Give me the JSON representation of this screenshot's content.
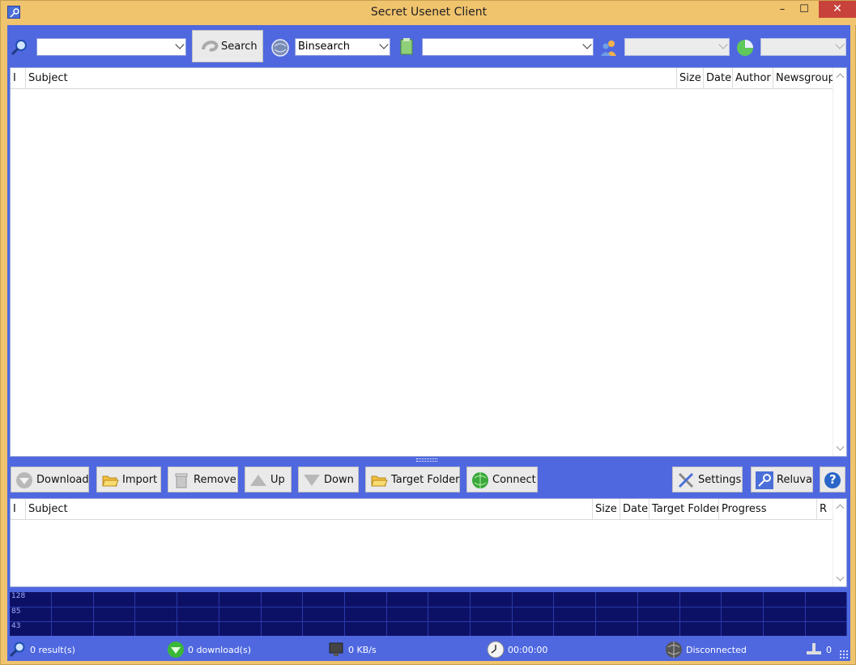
{
  "window": {
    "title": "Secret Usenet Client",
    "minimize": "–",
    "maximize": "☐",
    "close": "✕"
  },
  "toolbar": {
    "search_input": "",
    "search_label": "Search",
    "provider_selected": "Binsearch",
    "group_input": "",
    "user_select": "",
    "other_select": ""
  },
  "results": {
    "columns": [
      "I",
      "Subject",
      "Size",
      "Date",
      "Author",
      "Newsgroup"
    ],
    "rows": []
  },
  "actions": {
    "download": "Download",
    "import": "Import",
    "remove": "Remove",
    "up": "Up",
    "down": "Down",
    "target_folder": "Target Folder",
    "connect": "Connect",
    "settings": "Settings",
    "reluva": "Reluva",
    "help": "?"
  },
  "queue": {
    "columns": [
      "I",
      "Subject",
      "Size",
      "Date",
      "Target Folder",
      "Progress",
      "R"
    ],
    "rows": []
  },
  "graph": {
    "labels": [
      "128",
      "85",
      "43"
    ]
  },
  "status": {
    "results": "0 result(s)",
    "downloads": "0 download(s)",
    "speed": "0 KB/s",
    "time": "00:00:00",
    "connection": "Disconnected",
    "connections_count": "0"
  },
  "colors": {
    "frame": "#f0c36d",
    "client": "#4f68e0",
    "graph_bg": "#0d1166",
    "close": "#c7423a"
  }
}
